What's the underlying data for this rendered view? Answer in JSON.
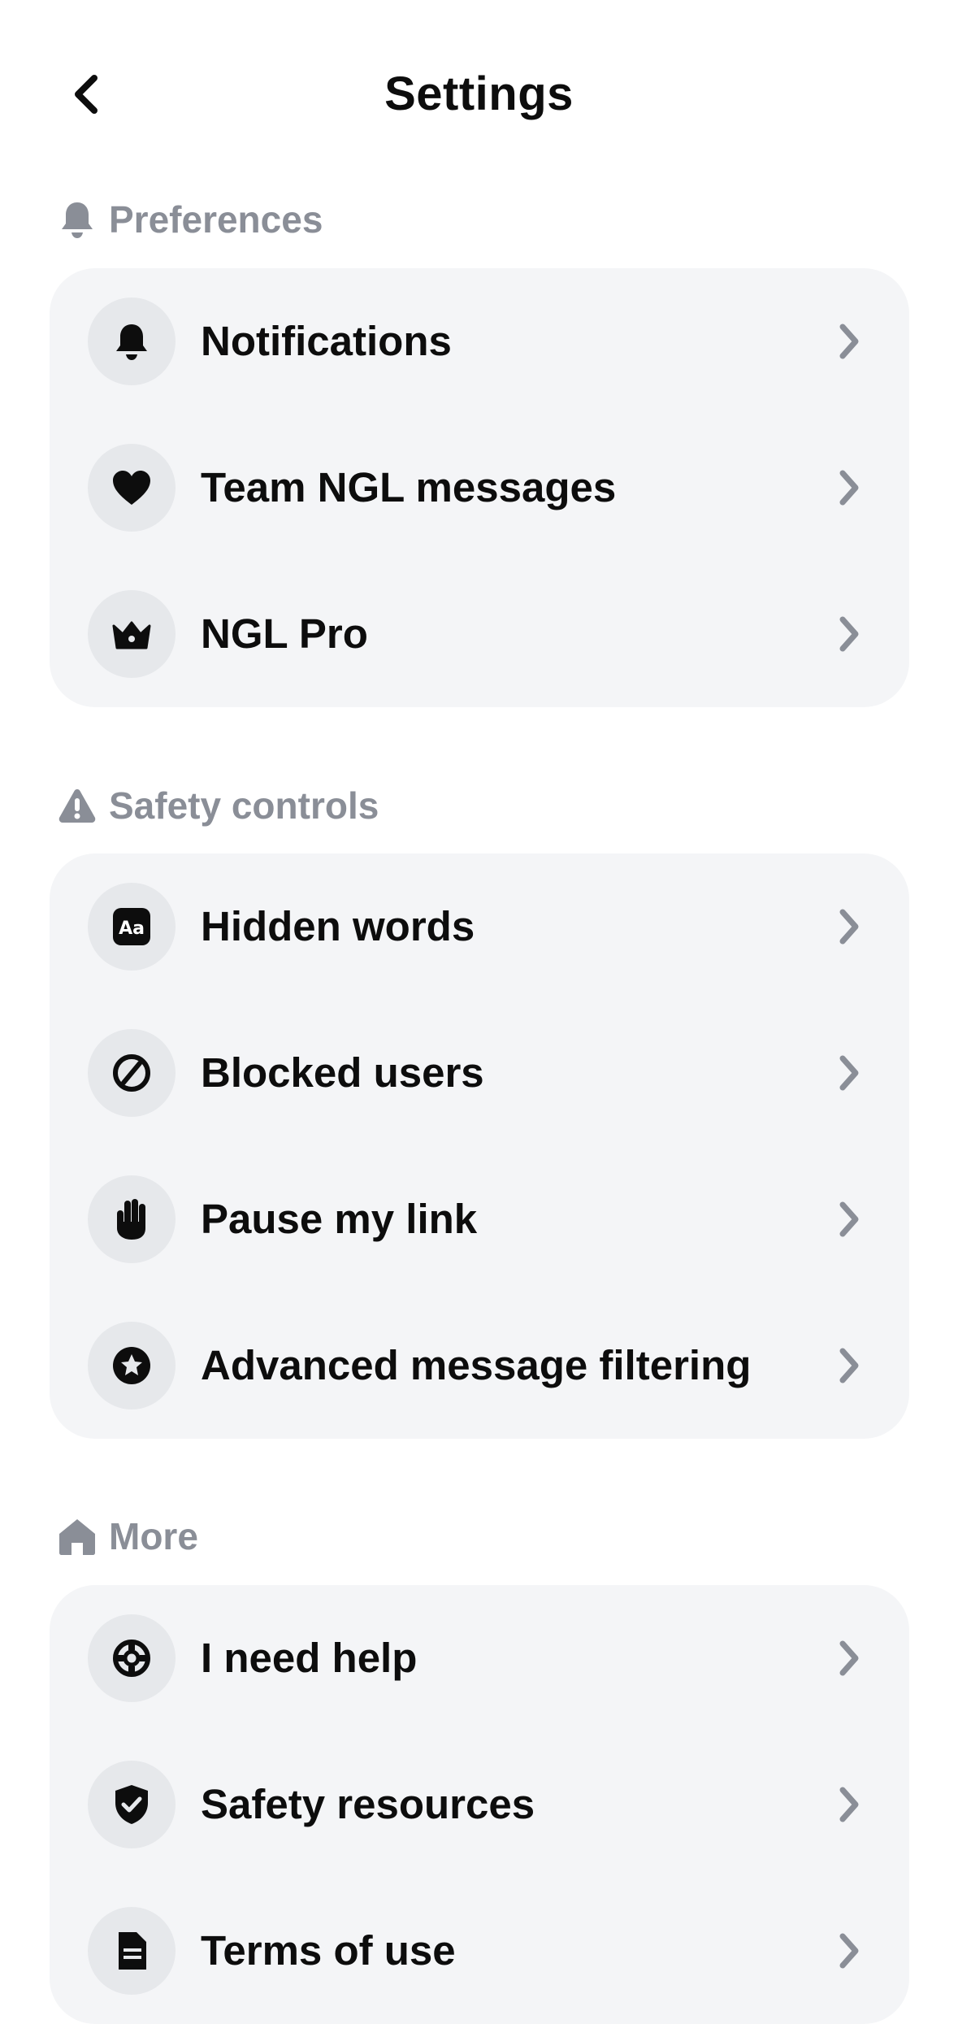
{
  "header": {
    "title": "Settings",
    "back_icon": "chevron-left-icon"
  },
  "sections": [
    {
      "label": "Preferences",
      "icon": "bell-icon",
      "items": [
        {
          "label": "Notifications",
          "icon": "bell-icon"
        },
        {
          "label": "Team NGL messages",
          "icon": "heart-icon"
        },
        {
          "label": "NGL Pro",
          "icon": "crown-icon"
        }
      ]
    },
    {
      "label": "Safety controls",
      "icon": "warning-icon",
      "items": [
        {
          "label": "Hidden words",
          "icon": "text-aa-icon"
        },
        {
          "label": "Blocked users",
          "icon": "block-icon"
        },
        {
          "label": "Pause my link",
          "icon": "hand-icon"
        },
        {
          "label": "Advanced message filtering",
          "icon": "star-badge-icon"
        }
      ]
    },
    {
      "label": "More",
      "icon": "home-icon",
      "items": [
        {
          "label": "I need help",
          "icon": "lifebuoy-icon"
        },
        {
          "label": "Safety resources",
          "icon": "shield-check-icon"
        },
        {
          "label": "Terms of use",
          "icon": "document-icon"
        }
      ]
    }
  ],
  "colors": {
    "section_label": "#8a8e97",
    "card_background": "#f4f5f7",
    "icon_circle": "#e6e8eb",
    "chevron": "#8a8e97",
    "text": "#0d0d0d"
  }
}
